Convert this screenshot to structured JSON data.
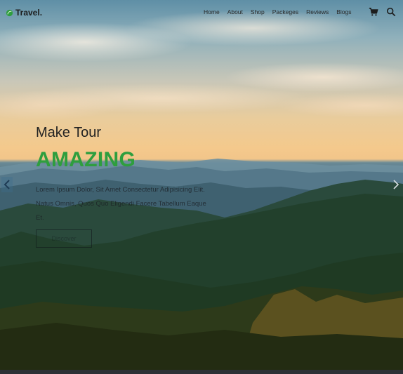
{
  "header": {
    "logo_text": "Travel.",
    "logo_icon": "leaf-icon",
    "nav": [
      {
        "label": "Home"
      },
      {
        "label": "About"
      },
      {
        "label": "Shop"
      },
      {
        "label": "Packeges"
      },
      {
        "label": "Reviews"
      },
      {
        "label": "Blogs"
      }
    ],
    "icons": [
      "cart-icon",
      "search-icon"
    ]
  },
  "hero": {
    "subtitle": "Make Tour",
    "title": "AMAZING",
    "description": "Lorem Ipsum Dolor, Sit Amet Consectetur Adipisicing Elit. Natus Omnis, Quos Quo Eligendi Facere Tabellum Eaque Et.",
    "cta_label": "Discover",
    "prev_icon": "chevron-left-icon",
    "next_icon": "chevron-right-icon"
  },
  "colors": {
    "accent": "#2e9e3e",
    "text_dark": "#222222"
  }
}
